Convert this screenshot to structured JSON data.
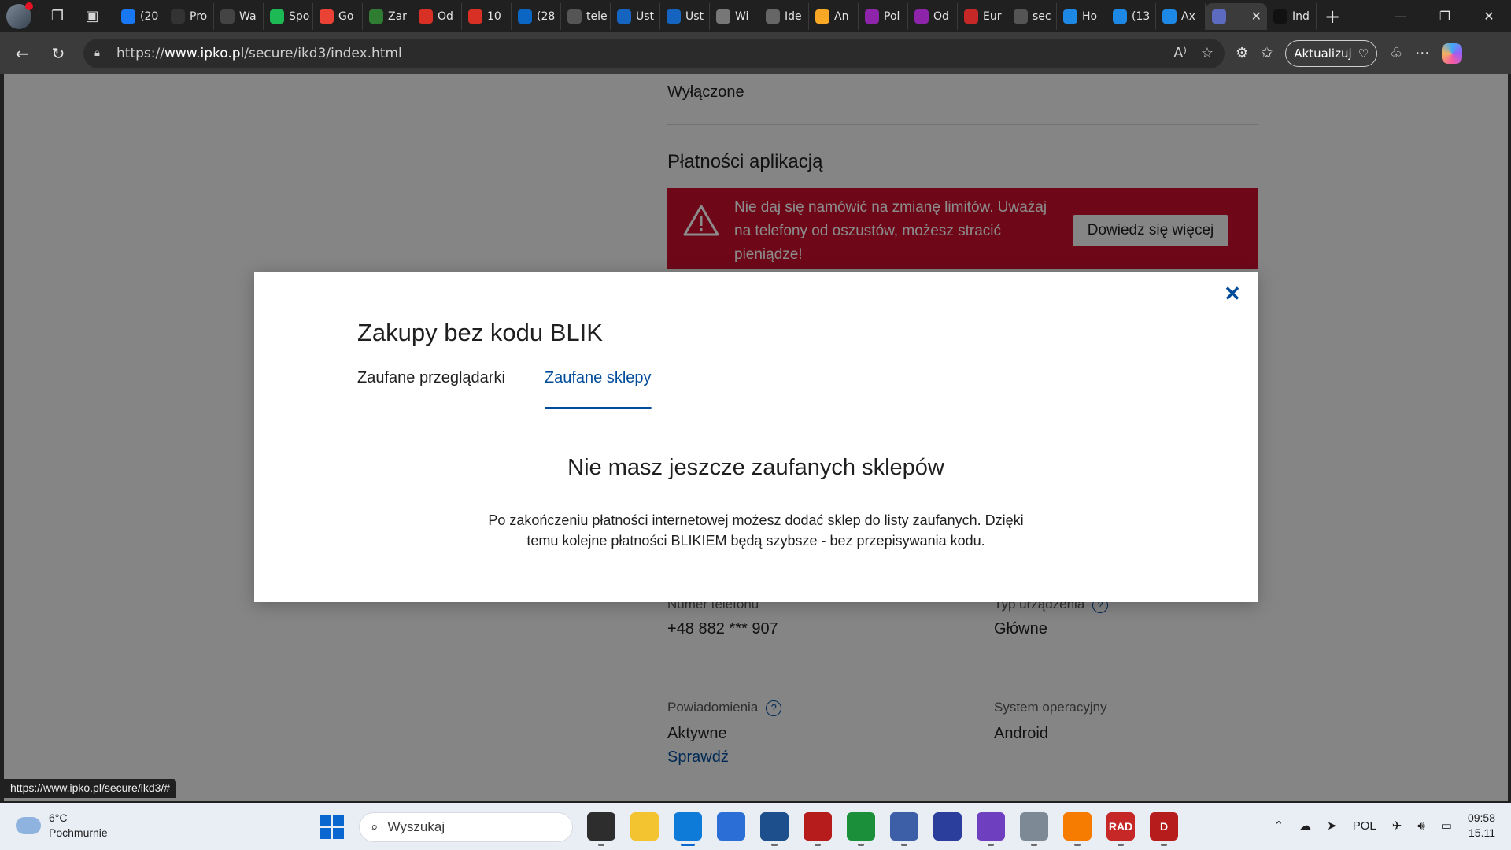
{
  "browser": {
    "tabs": [
      {
        "label": "(20",
        "icon": "facebook-icon",
        "color": "#1877f2"
      },
      {
        "label": "Pro",
        "icon": "gn-icon",
        "color": "#333333"
      },
      {
        "label": "Wa",
        "icon": "tws-icon",
        "color": "#444444"
      },
      {
        "label": "Spo",
        "icon": "spotify-icon",
        "color": "#1db954"
      },
      {
        "label": "Go",
        "icon": "google-icon",
        "color": "#ea4335"
      },
      {
        "label": "Zar",
        "icon": "leaf-icon",
        "color": "#2e7d32"
      },
      {
        "label": "Od",
        "icon": "gmail-icon",
        "color": "#d93025"
      },
      {
        "label": "10",
        "icon": "gmail-icon",
        "color": "#d93025"
      },
      {
        "label": "(28",
        "icon": "linkedin-icon",
        "color": "#0a66c2"
      },
      {
        "label": "tele",
        "icon": "search-icon",
        "color": "#555555"
      },
      {
        "label": "Ust",
        "icon": "eli-icon",
        "color": "#1565c0"
      },
      {
        "label": "Ust",
        "icon": "eli-icon",
        "color": "#1565c0"
      },
      {
        "label": "Wi",
        "icon": "wikipedia-icon",
        "color": "#777777"
      },
      {
        "label": "Ide",
        "icon": "wolf-icon",
        "color": "#666666"
      },
      {
        "label": "An",
        "icon": "chart-icon",
        "color": "#f9a825"
      },
      {
        "label": "Pol",
        "icon": "pinwheel-icon",
        "color": "#8e24aa"
      },
      {
        "label": "Od",
        "icon": "pinwheel-icon",
        "color": "#8e24aa"
      },
      {
        "label": "Eur",
        "icon": "logo-icon",
        "color": "#c62828"
      },
      {
        "label": "sec",
        "icon": "search-icon",
        "color": "#555555"
      },
      {
        "label": "Ho",
        "icon": "at-icon",
        "color": "#1e88e5"
      },
      {
        "label": "(13",
        "icon": "mail-icon",
        "color": "#1e88e5"
      },
      {
        "label": "Ax",
        "icon": "at-icon",
        "color": "#1e88e5"
      },
      {
        "label": "",
        "icon": "person-icon",
        "color": "#5c6bc0",
        "active": true
      },
      {
        "label": "Ind",
        "icon": "gn-icon",
        "color": "#111111"
      }
    ],
    "url_prefix": "https://",
    "url_host": "www.ipko.pl",
    "url_path": "/secure/ikd3/index.html",
    "update_label": "Aktualizuj",
    "status_url": "https://www.ipko.pl/secure/ikd3/#"
  },
  "background": {
    "top_value": "Wyłączone",
    "section_title": "Płatności aplikacją",
    "alert_text": "Nie daj się namówić na zmianę limitów. Uważaj na telefony od oszustów, możesz stracić pieniądze!",
    "alert_button": "Dowiedz się więcej",
    "phone_label": "Numer telefonu",
    "phone_value": "+48 882 *** 907",
    "device_label": "Typ urządzenia",
    "device_value": "Główne",
    "notif_label": "Powiadomienia",
    "notif_value": "Aktywne",
    "notif_link": "Sprawdź",
    "os_label": "System operacyjny",
    "os_value": "Android"
  },
  "modal": {
    "title": "Zakupy bez kodu BLIK",
    "tabs": [
      "Zaufane przeglądarki",
      "Zaufane sklepy"
    ],
    "active_tab": 1,
    "empty_title": "Nie masz jeszcze zaufanych sklepów",
    "empty_desc": "Po zakończeniu płatności internetowej możesz dodać sklep do listy zaufanych. Dzięki temu kolejne płatności BLIKIEM będą szybsze - bez przepisywania kodu.",
    "accent": "#004c9a"
  },
  "taskbar": {
    "temperature": "6°C",
    "weather": "Pochmurnie",
    "search_placeholder": "Wyszukaj",
    "language": "POL",
    "time": "09:58",
    "date": "15.11",
    "apps": [
      {
        "name": "file-manager-icon",
        "color": "#2d2d2d",
        "run": true
      },
      {
        "name": "folder-icon",
        "color": "#f4c430",
        "run": false
      },
      {
        "name": "edge-icon",
        "color": "#0f7bd8",
        "run": true,
        "active": true
      },
      {
        "name": "store-icon",
        "color": "#2b6fd6",
        "run": false
      },
      {
        "name": "virtualbox-icon",
        "color": "#1c4f8c",
        "run": true
      },
      {
        "name": "davinci-icon",
        "color": "#b71c1c",
        "run": true
      },
      {
        "name": "app-green-icon",
        "color": "#1b8f3a",
        "run": true
      },
      {
        "name": "network-icon",
        "color": "#3c5fa8",
        "run": true
      },
      {
        "name": "save-icon",
        "color": "#2c3e9c",
        "run": false
      },
      {
        "name": "github-icon",
        "color": "#6e3fbf",
        "run": true
      },
      {
        "name": "disk-icon",
        "color": "#7d8a96",
        "run": true
      },
      {
        "name": "vlc-icon",
        "color": "#f57c00",
        "run": true
      },
      {
        "name": "rad-icon",
        "color": "#c62828",
        "label": "RAD",
        "run": true
      },
      {
        "name": "d-icon",
        "color": "#b71c1c",
        "label": "D",
        "run": true
      }
    ]
  }
}
